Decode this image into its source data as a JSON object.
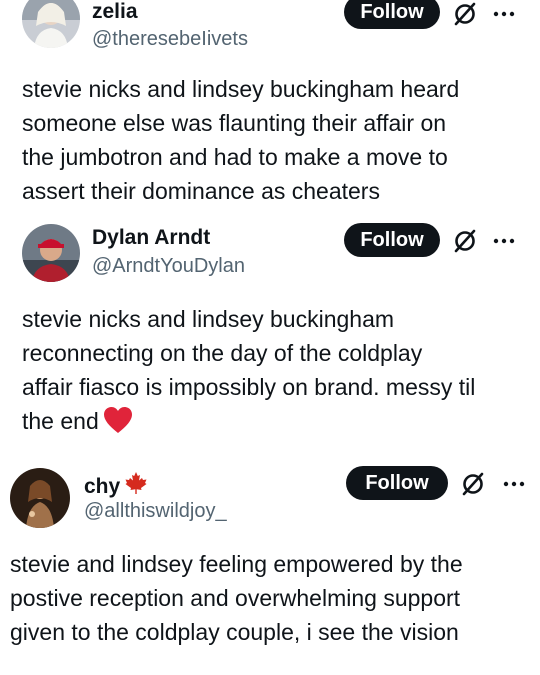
{
  "posts": [
    {
      "display_name": "zelia",
      "handle": "@theresebeIivets",
      "follow_label": "Follow",
      "avatar_icon": "user-photo",
      "text_lines": [
        "stevie nicks and lindsey buckingham heard",
        "someone else was flaunting their affair on",
        "the jumbotron and had to make a move to",
        "assert their dominance as cheaters"
      ]
    },
    {
      "display_name": "Dylan Arndt",
      "handle": "@ArndtYouDylan",
      "follow_label": "Follow",
      "avatar_icon": "user-photo",
      "text_lines": [
        "stevie nicks and lindsey buckingham",
        "reconnecting on the day of the coldplay",
        "affair fiasco is impossibly on brand. messy til",
        "the end"
      ],
      "trailing_emoji": "red-heart-icon"
    },
    {
      "display_name": "chy",
      "name_emoji": "maple-leaf-icon",
      "handle": "@allthiswildjoy_",
      "follow_label": "Follow",
      "avatar_icon": "user-photo",
      "text_lines": [
        "stevie and lindsey feeling empowered by the",
        "postive reception and overwhelming support",
        "given to the coldplay couple, i see the vision"
      ]
    }
  ],
  "colors": {
    "text": "#0f1419",
    "secondary": "#536471",
    "button_bg": "#0f1419",
    "button_text": "#ffffff",
    "heart": "#e0243a",
    "maple": "#d52b1e"
  }
}
